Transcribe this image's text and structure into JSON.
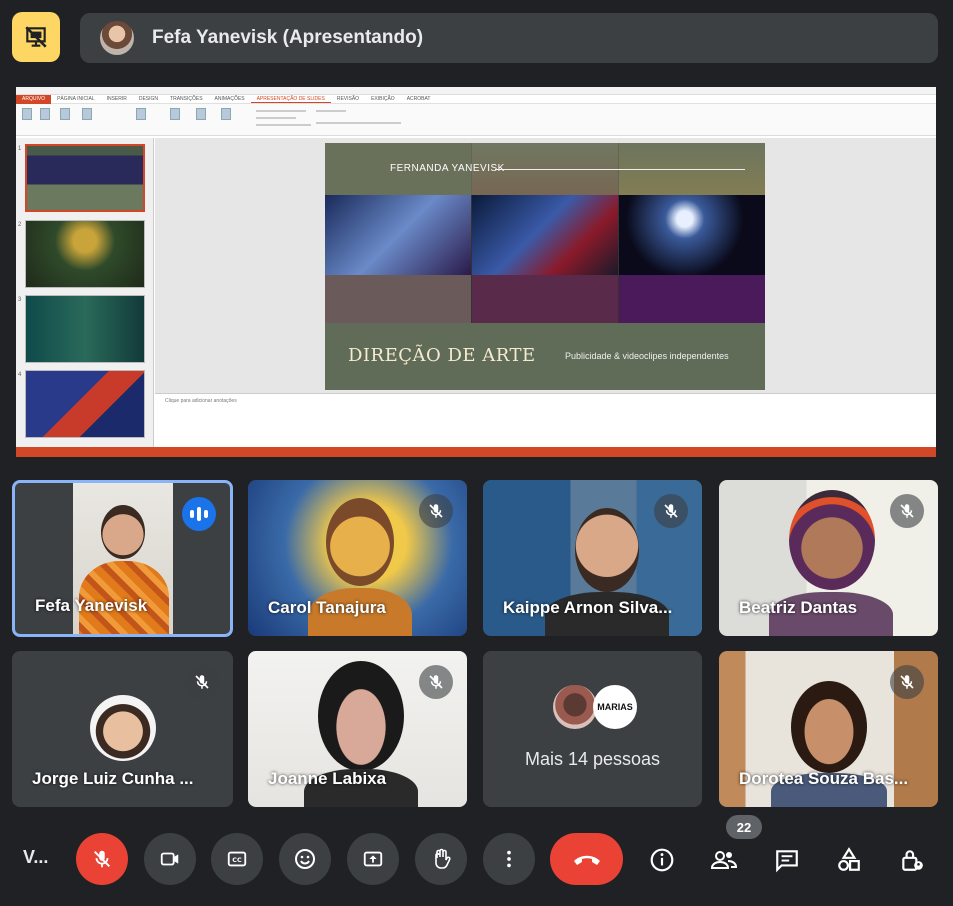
{
  "header": {
    "presenter_label": "Fefa Yanevisk (Apresentando)",
    "presentation_icon": "presentation-off-icon"
  },
  "slide": {
    "author": "FERNANDA YANEVISK",
    "title": "DIREÇÃO DE ARTE",
    "subtitle": "Publicidade & videoclipes independentes"
  },
  "ppt": {
    "tabs": [
      "ARQUIVO",
      "PÁGINA INICIAL",
      "INSERIR",
      "DESIGN",
      "TRANSIÇÕES",
      "ANIMAÇÕES",
      "APRESENTAÇÃO DE SLIDES",
      "REVISÃO",
      "EXIBIÇÃO",
      "ACROBAT"
    ],
    "notes_placeholder": "Clique para adicionar anotações",
    "thumb_numbers": [
      "1",
      "2",
      "3",
      "4"
    ]
  },
  "participants": [
    {
      "name": "Fefa Yanevisk",
      "speaking": true,
      "muted": false
    },
    {
      "name": "Carol Tanajura",
      "speaking": false,
      "muted": true
    },
    {
      "name": "Kaippe Arnon Silva...",
      "speaking": false,
      "muted": true
    },
    {
      "name": "Beatriz Dantas",
      "speaking": false,
      "muted": true
    },
    {
      "name": "Jorge Luiz Cunha ...",
      "speaking": false,
      "muted": true
    },
    {
      "name": "Joanne Labixa",
      "speaking": false,
      "muted": true
    },
    {
      "name": "Dorotea Souza Bas...",
      "speaking": false,
      "muted": true
    }
  ],
  "more_people": {
    "label": "Mais 14 pessoas",
    "avatar2_text": "MARIAS"
  },
  "toolbar": {
    "meeting_code": "V...",
    "participant_count": "22",
    "end_call_color": "#ea4335",
    "accent_color": "#8ab4f8"
  }
}
